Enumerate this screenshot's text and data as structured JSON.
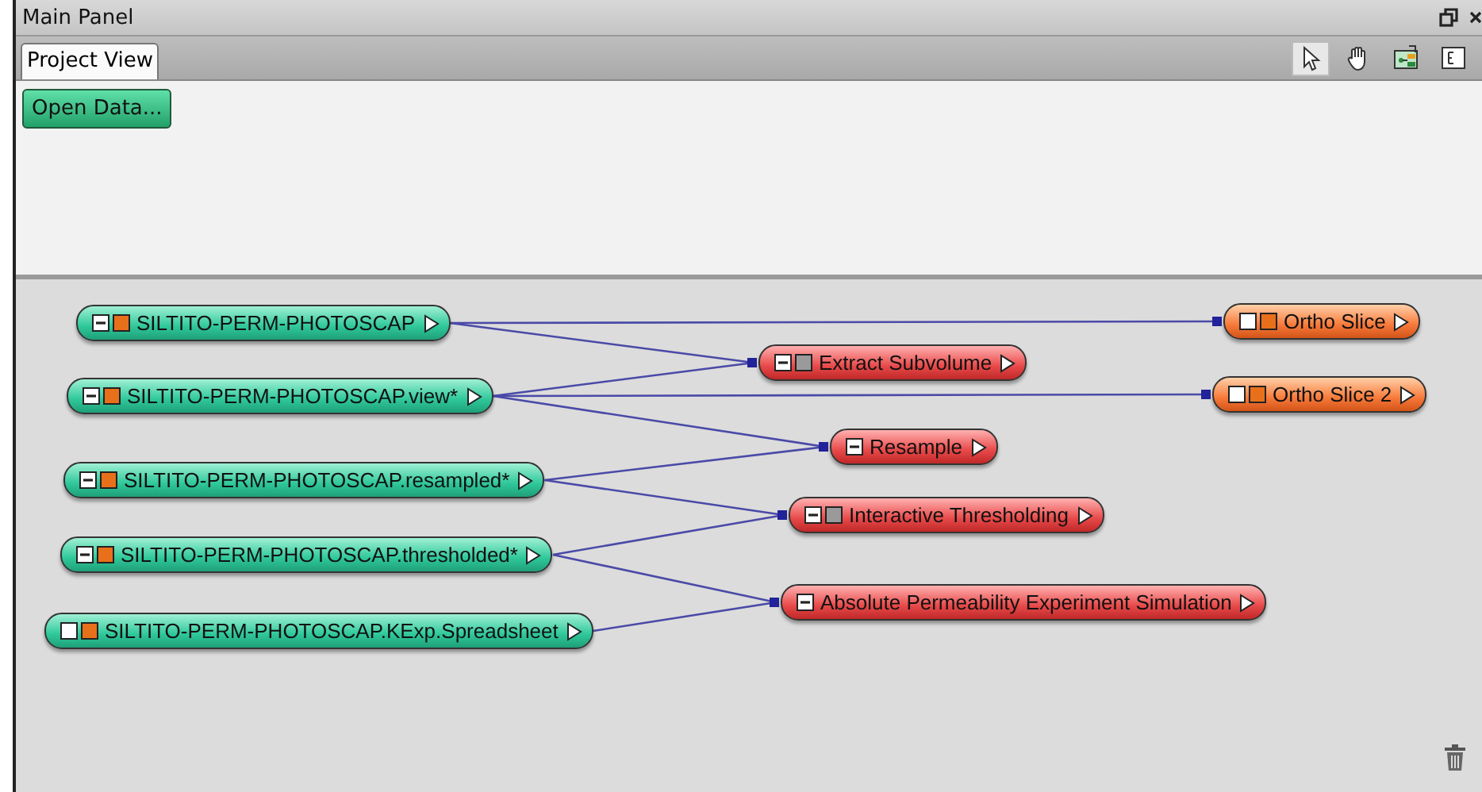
{
  "panel": {
    "title": "Main Panel"
  },
  "tabs": [
    {
      "label": "Project View",
      "selected": true
    }
  ],
  "toolbar": [
    {
      "kind": "pointer",
      "selected": true
    },
    {
      "kind": "hand",
      "selected": false
    },
    {
      "kind": "graph",
      "selected": false
    },
    {
      "kind": "layout",
      "selected": false
    }
  ],
  "open_button": "Open Data...",
  "nodes": [
    {
      "kind": "data",
      "label": "SILTITO-PERM-PHOTOSCAP",
      "expanded": true,
      "color": "#e8701a"
    },
    {
      "kind": "data",
      "label": "SILTITO-PERM-PHOTOSCAP.view*",
      "expanded": true,
      "color": "#e8701a"
    },
    {
      "kind": "data",
      "label": "SILTITO-PERM-PHOTOSCAP.resampled*",
      "expanded": true,
      "color": "#e8701a"
    },
    {
      "kind": "data",
      "label": "SILTITO-PERM-PHOTOSCAP.thresholded*",
      "expanded": true,
      "color": "#e8701a"
    },
    {
      "kind": "data",
      "label": "SILTITO-PERM-PHOTOSCAP.KExp.Spreadsheet",
      "expanded": false,
      "color": "#e8701a"
    },
    {
      "kind": "compute",
      "label": "Extract Subvolume",
      "expanded": true,
      "color": "#9a9a9a"
    },
    {
      "kind": "compute",
      "label": "Resample",
      "expanded": true
    },
    {
      "kind": "compute",
      "label": "Interactive Thresholding",
      "expanded": true,
      "color": "#9a9a9a"
    },
    {
      "kind": "compute",
      "label": "Absolute Permeability Experiment Simulation",
      "expanded": true
    },
    {
      "kind": "display",
      "label": "Ortho Slice",
      "expanded": false,
      "color": "#e8701a"
    },
    {
      "kind": "display",
      "label": "Ortho Slice 2",
      "expanded": false,
      "color": "#e8701a"
    }
  ]
}
